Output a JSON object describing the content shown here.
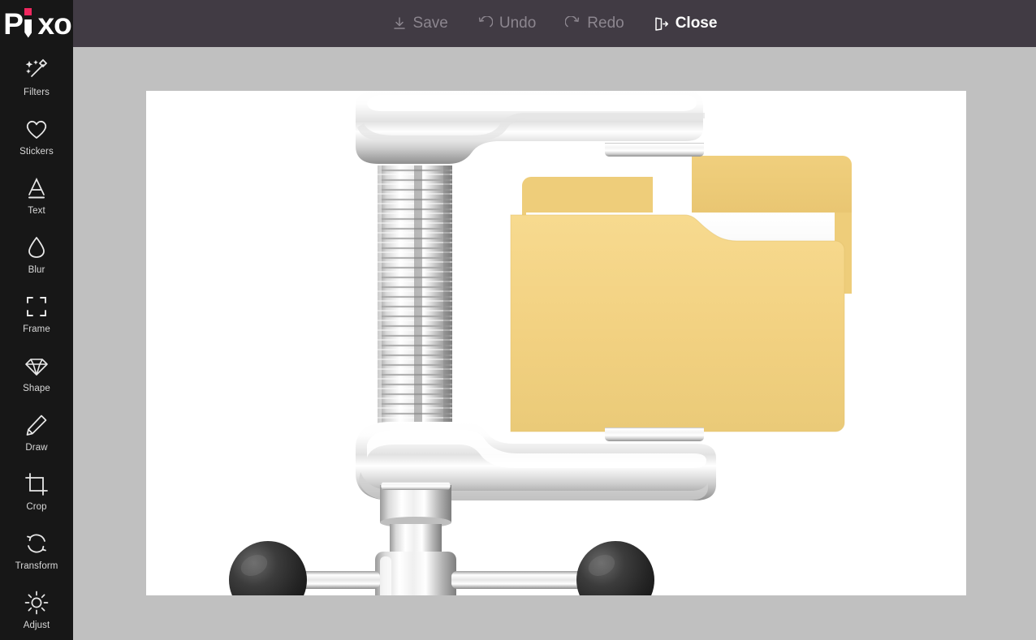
{
  "app": {
    "brand": "Pixo",
    "brand_accent_color": "#f0275f",
    "sidebar_bg": "#171717",
    "header_bg": "#413b44",
    "workspace_bg": "#c0c0c0",
    "canvas_bg": "#ffffff"
  },
  "header": {
    "buttons": [
      {
        "label": "Save",
        "icon": "download-icon",
        "state": "disabled"
      },
      {
        "label": "Undo",
        "icon": "undo-arrow-icon",
        "state": "disabled"
      },
      {
        "label": "Redo",
        "icon": "redo-arrow-icon",
        "state": "disabled"
      },
      {
        "label": "Close",
        "icon": "exit-door-icon",
        "state": "active"
      }
    ]
  },
  "sidebar": {
    "items": [
      {
        "label": "Filters",
        "icon": "magic-wand-icon"
      },
      {
        "label": "Stickers",
        "icon": "heart-icon"
      },
      {
        "label": "Text",
        "icon": "letter-a-icon"
      },
      {
        "label": "Blur",
        "icon": "water-drop-icon"
      },
      {
        "label": "Frame",
        "icon": "frame-corners-icon"
      },
      {
        "label": "Shape",
        "icon": "diamond-icon"
      },
      {
        "label": "Draw",
        "icon": "pencil-icon"
      },
      {
        "label": "Crop",
        "icon": "crop-icon"
      },
      {
        "label": "Transform",
        "icon": "rotate-arrows-icon"
      },
      {
        "label": "Adjust",
        "icon": "brightness-sun-icon"
      }
    ]
  },
  "canvas": {
    "image_description": "Metal C-clamp / vise squeezing a yellow file folder — file compression illustration",
    "colors": {
      "folder_front": "#f3d281",
      "folder_back": "#e9c672",
      "folder_mid": "#eecd7a",
      "paper": "#f6f6f6",
      "metal_light": "#ffffff",
      "metal_mid": "#cfcfcf",
      "metal_dark": "#8e8e8e",
      "knob_dark": "#2e2e2e"
    }
  }
}
